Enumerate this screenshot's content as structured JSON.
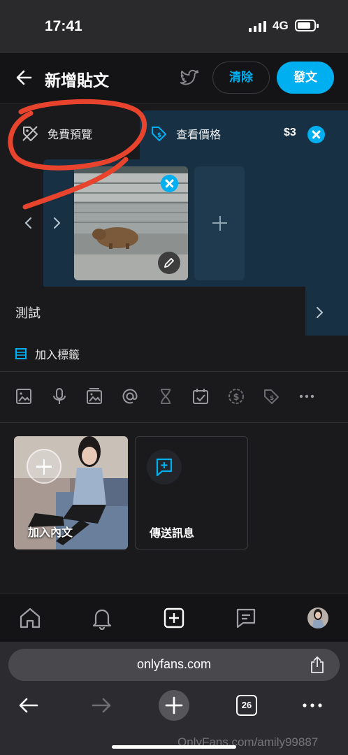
{
  "status": {
    "time": "17:41",
    "network": "4G"
  },
  "header": {
    "title": "新增貼文",
    "clear_label": "清除",
    "post_label": "發文"
  },
  "post": {
    "free_preview_label": "免費預覽",
    "view_price_label": "查看價格",
    "price": "$3",
    "caption": "測試",
    "add_tag_label": "加入標籤"
  },
  "cards": {
    "add_content_label": "加入內文",
    "send_message_label": "傳送訊息"
  },
  "browser": {
    "url": "onlyfans.com",
    "tab_count": "26"
  },
  "watermark": "OnlyFans.com/amily99887",
  "icons": {
    "toolbar": [
      "image-icon",
      "microphone-icon",
      "media-vault-icon",
      "mention-icon",
      "hourglass-icon",
      "calendar-check-icon",
      "price-icon",
      "tag-icon",
      "more-icon"
    ],
    "bottom_nav": [
      "home-icon",
      "bell-icon",
      "plus-square-icon",
      "message-icon",
      "avatar"
    ]
  },
  "colors": {
    "accent": "#00aff0",
    "annotation": "#e8442d"
  }
}
